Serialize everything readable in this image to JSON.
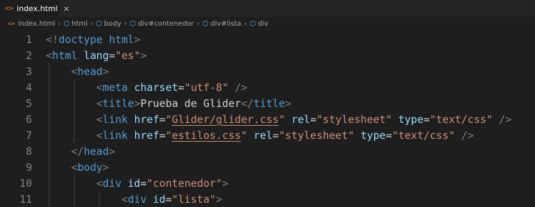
{
  "tab": {
    "filename": "index.html",
    "icon": "html-file-icon",
    "close": "×"
  },
  "breadcrumb": [
    "index.html",
    "html",
    "body",
    "div#contenedor",
    "div#lista",
    "div"
  ],
  "lines": [
    {
      "num": "1",
      "tokens": [
        [
          "p",
          "<!"
        ],
        [
          "t",
          "doctype"
        ],
        [
          "x",
          " "
        ],
        [
          "t",
          "html"
        ],
        [
          "p",
          ">"
        ]
      ]
    },
    {
      "num": "2",
      "tokens": [
        [
          "p",
          "<"
        ],
        [
          "t",
          "html"
        ],
        [
          "x",
          " "
        ],
        [
          "a",
          "lang"
        ],
        [
          "x",
          "="
        ],
        [
          "s",
          "\"es\""
        ],
        [
          "p",
          ">"
        ]
      ]
    },
    {
      "num": "3",
      "tokens": [
        [
          "x",
          "    "
        ],
        [
          "p",
          "<"
        ],
        [
          "t",
          "head"
        ],
        [
          "p",
          ">"
        ]
      ]
    },
    {
      "num": "4",
      "tokens": [
        [
          "x",
          "        "
        ],
        [
          "p",
          "<"
        ],
        [
          "t",
          "meta"
        ],
        [
          "x",
          " "
        ],
        [
          "a",
          "charset"
        ],
        [
          "x",
          "="
        ],
        [
          "s",
          "\"utf-8\""
        ],
        [
          "x",
          " "
        ],
        [
          "p",
          "/>"
        ]
      ]
    },
    {
      "num": "5",
      "tokens": [
        [
          "x",
          "        "
        ],
        [
          "p",
          "<"
        ],
        [
          "t",
          "title"
        ],
        [
          "p",
          ">"
        ],
        [
          "x",
          "Prueba de Glider"
        ],
        [
          "p",
          "</"
        ],
        [
          "t",
          "title"
        ],
        [
          "p",
          ">"
        ]
      ]
    },
    {
      "num": "6",
      "tokens": [
        [
          "x",
          "        "
        ],
        [
          "p",
          "<"
        ],
        [
          "t",
          "link"
        ],
        [
          "x",
          " "
        ],
        [
          "a",
          "href"
        ],
        [
          "x",
          "="
        ],
        [
          "s",
          "\""
        ],
        [
          "su",
          "Glider/glider.css"
        ],
        [
          "s",
          "\""
        ],
        [
          "x",
          " "
        ],
        [
          "a",
          "rel"
        ],
        [
          "x",
          "="
        ],
        [
          "s",
          "\"stylesheet\""
        ],
        [
          "x",
          " "
        ],
        [
          "a",
          "type"
        ],
        [
          "x",
          "="
        ],
        [
          "s",
          "\"text/css\""
        ],
        [
          "x",
          " "
        ],
        [
          "p",
          "/>"
        ]
      ]
    },
    {
      "num": "7",
      "tokens": [
        [
          "x",
          "        "
        ],
        [
          "p",
          "<"
        ],
        [
          "t",
          "link"
        ],
        [
          "x",
          " "
        ],
        [
          "a",
          "href"
        ],
        [
          "x",
          "="
        ],
        [
          "s",
          "\""
        ],
        [
          "su",
          "estilos.css"
        ],
        [
          "s",
          "\""
        ],
        [
          "x",
          " "
        ],
        [
          "a",
          "rel"
        ],
        [
          "x",
          "="
        ],
        [
          "s",
          "\"stylesheet\""
        ],
        [
          "x",
          " "
        ],
        [
          "a",
          "type"
        ],
        [
          "x",
          "="
        ],
        [
          "s",
          "\"text/css\""
        ],
        [
          "x",
          " "
        ],
        [
          "p",
          "/>"
        ]
      ]
    },
    {
      "num": "8",
      "tokens": [
        [
          "x",
          "    "
        ],
        [
          "p",
          "</"
        ],
        [
          "t",
          "head"
        ],
        [
          "p",
          ">"
        ]
      ]
    },
    {
      "num": "9",
      "tokens": [
        [
          "x",
          "    "
        ],
        [
          "p",
          "<"
        ],
        [
          "t",
          "body"
        ],
        [
          "p",
          ">"
        ]
      ]
    },
    {
      "num": "10",
      "tokens": [
        [
          "x",
          "        "
        ],
        [
          "p",
          "<"
        ],
        [
          "t",
          "div"
        ],
        [
          "x",
          " "
        ],
        [
          "a",
          "id"
        ],
        [
          "x",
          "="
        ],
        [
          "s",
          "\"contenedor\""
        ],
        [
          "p",
          ">"
        ]
      ]
    },
    {
      "num": "11",
      "tokens": [
        [
          "x",
          "            "
        ],
        [
          "p",
          "<"
        ],
        [
          "t",
          "div"
        ],
        [
          "x",
          " "
        ],
        [
          "a",
          "id"
        ],
        [
          "x",
          "="
        ],
        [
          "s",
          "\"lista\""
        ],
        [
          "p",
          ">"
        ]
      ]
    }
  ]
}
